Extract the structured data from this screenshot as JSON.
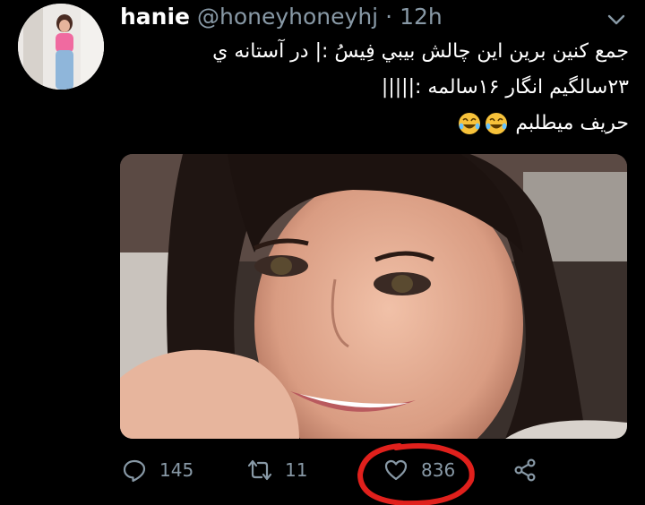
{
  "tweet": {
    "user": {
      "name": "hanie",
      "handle": "@honeyhoneyhj",
      "separator": "·",
      "time": "12h",
      "avatar_icon": "profile-photo-avatar"
    },
    "text_lines": [
      "جمع کنین برین این چالش بیبي فِیسُ :| در آستانه ي",
      "۲۳سالگیم انگار ۱۶سالمه :|||||",
      "حریف میطلبم"
    ],
    "emoji": [
      "rofl-emoji",
      "rofl-emoji"
    ],
    "media_description_icon": "tweet-photo"
  },
  "actions": {
    "reply": {
      "icon": "reply-icon",
      "count": "145"
    },
    "retweet": {
      "icon": "retweet-icon",
      "count": "11"
    },
    "like": {
      "icon": "heart-icon",
      "count": "836"
    },
    "share": {
      "icon": "share-icon"
    }
  },
  "annotation": {
    "color": "#e0201c"
  },
  "colors": {
    "background": "#000000",
    "muted": "#8899a6",
    "text": "#ffffff"
  }
}
